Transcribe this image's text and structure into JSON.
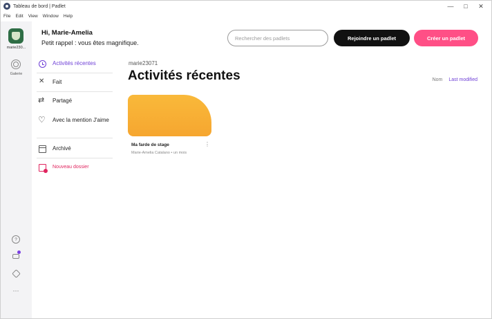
{
  "window": {
    "title": "Tableau de bord | Padlet",
    "controls": {
      "minimize": "—",
      "maximize": "□",
      "close": "✕"
    }
  },
  "menu": [
    "File",
    "Edit",
    "View",
    "Window",
    "Help"
  ],
  "rail": {
    "username": "marie230...",
    "gallery_label": "Galerie",
    "more": "···"
  },
  "header": {
    "greeting": "Hi, Marie-Amelia",
    "reminder": "Petit rappel : vous êtes magnifique.",
    "search_placeholder": "Rechercher des padlets",
    "join_label": "Rejoindre un padlet",
    "create_label": "Créer un padlet"
  },
  "nav": {
    "recent": "Activités récentes",
    "done": "Fait",
    "shared": "Partagé",
    "liked": "Avec la mention J'aime",
    "archived": "Archivé",
    "new_folder": "Nouveau dossier"
  },
  "main": {
    "crumb": "marie23071",
    "title": "Activités récentes",
    "sort_name": "Nom",
    "sort_modified": "Last modified"
  },
  "card": {
    "title": "Ma farde de stage",
    "meta": "Marie-Amelia Catalano • un mois",
    "menu": "⋮"
  },
  "colors": {
    "accent_purple": "#6e3fd6",
    "create_pink": "#ff4f86",
    "new_folder_red": "#e0245e",
    "card_orange": "#f7ad34"
  }
}
